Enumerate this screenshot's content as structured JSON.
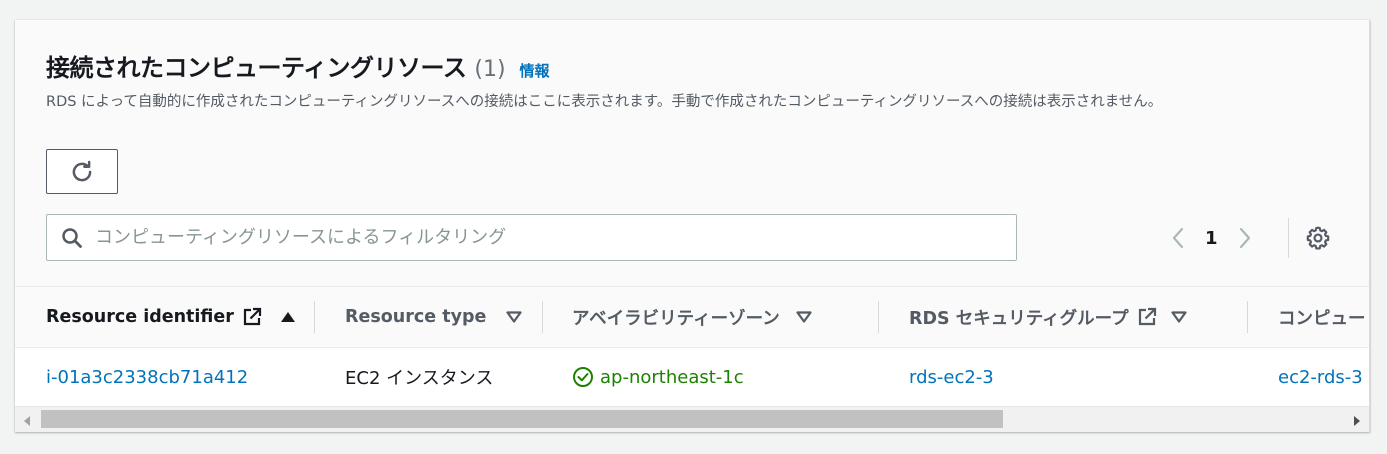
{
  "header": {
    "title": "接続されたコンピューティングリソース",
    "count": "(1)",
    "info_link": "情報",
    "description": "RDS によって自動的に作成されたコンピューティングリソースへの接続はここに表示されます。手動で作成されたコンピューティングリソースへの接続は表示されません。"
  },
  "toolbar": {
    "refresh_icon": "refresh-icon"
  },
  "search": {
    "placeholder": "コンピューティングリソースによるフィルタリング",
    "value": ""
  },
  "pagination": {
    "current_page": "1"
  },
  "table": {
    "columns": [
      {
        "label": "Resource identifier",
        "external_link": true,
        "sort": "ascending"
      },
      {
        "label": "Resource type",
        "external_link": false,
        "sort": "none"
      },
      {
        "label": "アベイラビリティーゾーン",
        "external_link": false,
        "sort": "none"
      },
      {
        "label": "RDS セキュリティグループ",
        "external_link": true,
        "sort": "none"
      },
      {
        "label": "コンピュー",
        "external_link": false,
        "sort": "none"
      }
    ],
    "rows": [
      {
        "resource_identifier": "i-01a3c2338cb71a412",
        "resource_type": "EC2 インスタンス",
        "availability_zone": "ap-northeast-1c",
        "rds_security_group": "rds-ec2-3",
        "compute_security_group": "ec2-rds-3"
      }
    ]
  },
  "colors": {
    "link": "#0073bb",
    "success": "#1d8102",
    "text": "#16191f",
    "muted": "#545b64"
  }
}
